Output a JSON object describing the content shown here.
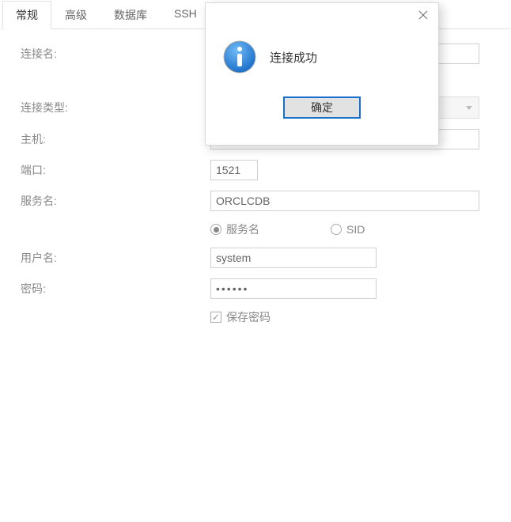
{
  "tabs": {
    "general": "常规",
    "advanced": "高级",
    "database": "数据库",
    "ssh": "SSH"
  },
  "labels": {
    "connection_name": "连接名:",
    "connection_type": "连接类型:",
    "host": "主机:",
    "port": "端口:",
    "service_name": "服务名:",
    "username": "用户名:",
    "password": "密码:"
  },
  "fields": {
    "connection_name": "",
    "connection_type": "",
    "host": "",
    "port": "1521",
    "service_name": "ORCLCDB",
    "username": "system",
    "password": "••••••"
  },
  "radio": {
    "service_name": "服务名",
    "sid": "SID"
  },
  "checkbox": {
    "save_password": "保存密码"
  },
  "modal": {
    "message": "连接成功",
    "ok": "确定"
  }
}
